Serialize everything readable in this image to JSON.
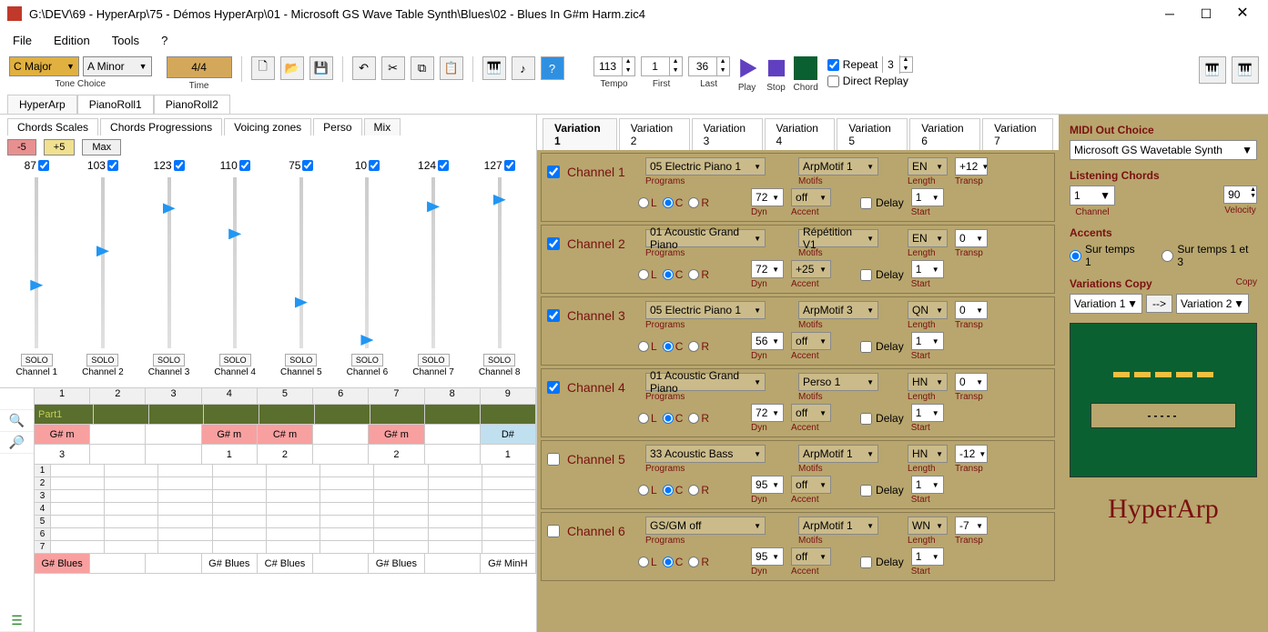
{
  "title_bar": "G:\\DEV\\69 - HyperArp\\75 - Démos HyperArp\\01  - Microsoft GS Wave Table Synth\\Blues\\02 - Blues In G#m Harm.zic4",
  "menu": [
    "File",
    "Edition",
    "Tools",
    "?"
  ],
  "toolbar": {
    "tone1": "C Major",
    "tone2": "A Minor",
    "tone_label": "Tone Choice",
    "time_sig": "4/4",
    "time_label": "Time",
    "tempo": "113",
    "tempo_label": "Tempo",
    "first": "1",
    "first_label": "First",
    "last": "36",
    "last_label": "Last",
    "play_label": "Play",
    "stop_label": "Stop",
    "chord_label": "Chord",
    "repeat_label": "Repeat",
    "repeat_val": "3",
    "direct_replay": "Direct Replay"
  },
  "main_tabs": [
    "HyperArp",
    "PianoRoll1",
    "PianoRoll2"
  ],
  "sub_tabs": [
    "Chords Scales",
    "Chords Progressions",
    "Voicing zones",
    "Perso",
    "Mix"
  ],
  "mix_btns": {
    "neg": "-5",
    "pos": "+5",
    "max": "Max"
  },
  "solo": "SOLO",
  "channels_mix": [
    {
      "val": "87",
      "pos": 60,
      "label": "Channel 1"
    },
    {
      "val": "103",
      "pos": 40,
      "label": "Channel 2"
    },
    {
      "val": "123",
      "pos": 15,
      "label": "Channel 3"
    },
    {
      "val": "110",
      "pos": 30,
      "label": "Channel 4"
    },
    {
      "val": "75",
      "pos": 70,
      "label": "Channel 5"
    },
    {
      "val": "10",
      "pos": 92,
      "label": "Channel 6"
    },
    {
      "val": "124",
      "pos": 14,
      "label": "Channel 7"
    },
    {
      "val": "127",
      "pos": 10,
      "label": "Channel 8"
    }
  ],
  "grid": {
    "headers": [
      "1",
      "2",
      "3",
      "4",
      "5",
      "6",
      "7",
      "8",
      "9"
    ],
    "part": "Part1",
    "chord_row": [
      "G# m",
      "",
      "",
      "G# m",
      "C# m",
      "",
      "G# m",
      "",
      "D#"
    ],
    "num_row": [
      "3",
      "",
      "",
      "1",
      "2",
      "",
      "2",
      "",
      "1"
    ],
    "blues_row": [
      "G# Blues",
      "",
      "",
      "G# Blues",
      "C# Blues",
      "",
      "G# Blues",
      "",
      "G# MinH"
    ]
  },
  "var_tabs": [
    "Variation 1",
    "Variation 2",
    "Variation 3",
    "Variation 4",
    "Variation 5",
    "Variation 6",
    "Variation 7"
  ],
  "var_channels": [
    {
      "checked": true,
      "name": "Channel 1",
      "program": "05 Electric Piano 1",
      "motif": "ArpMotif 1",
      "length": "EN",
      "transp": "+12",
      "dyn": "72",
      "accent": "off",
      "start": "1"
    },
    {
      "checked": true,
      "name": "Channel 2",
      "program": "01 Acoustic Grand Piano",
      "motif": "Répétition V1",
      "length": "EN",
      "transp": "0",
      "dyn": "72",
      "accent": "+25",
      "start": "1"
    },
    {
      "checked": true,
      "name": "Channel 3",
      "program": "05 Electric Piano 1",
      "motif": "ArpMotif 3",
      "length": "QN",
      "transp": "0",
      "dyn": "56",
      "accent": "off",
      "start": "1"
    },
    {
      "checked": true,
      "name": "Channel 4",
      "program": "01 Acoustic Grand Piano",
      "motif": "Perso 1",
      "length": "HN",
      "transp": "0",
      "dyn": "72",
      "accent": "off",
      "start": "1"
    },
    {
      "checked": false,
      "name": "Channel 5",
      "program": "33 Acoustic Bass",
      "motif": "ArpMotif 1",
      "length": "HN",
      "transp": "-12",
      "dyn": "95",
      "accent": "off",
      "start": "1"
    },
    {
      "checked": false,
      "name": "Channel 6",
      "program": "GS/GM off",
      "motif": "ArpMotif 1",
      "length": "WN",
      "transp": "-7",
      "dyn": "95",
      "accent": "off",
      "start": "1"
    }
  ],
  "cb_labels": {
    "programs": "Programs",
    "motifs": "Motifs",
    "length": "Length",
    "transp": "Transp",
    "dyn": "Dyn",
    "accent": "Accent",
    "delay": "Delay",
    "start": "Start",
    "L": "L",
    "C": "C",
    "R": "R"
  },
  "right": {
    "midi_out": "MIDI Out Choice",
    "midi_val": "Microsoft GS Wavetable Synth",
    "listening": "Listening Chords",
    "channel": "1",
    "channel_lbl": "Channel",
    "velocity": "90",
    "velocity_lbl": "Velocity",
    "accents": "Accents",
    "acc1": "Sur temps 1",
    "acc2": "Sur temps 1 et 3",
    "var_copy": "Variations Copy",
    "copy_lbl": "Copy",
    "copy_from": "Variation 1",
    "copy_arrow": "-->",
    "copy_to": "Variation 2",
    "logo": "HyperArp"
  }
}
